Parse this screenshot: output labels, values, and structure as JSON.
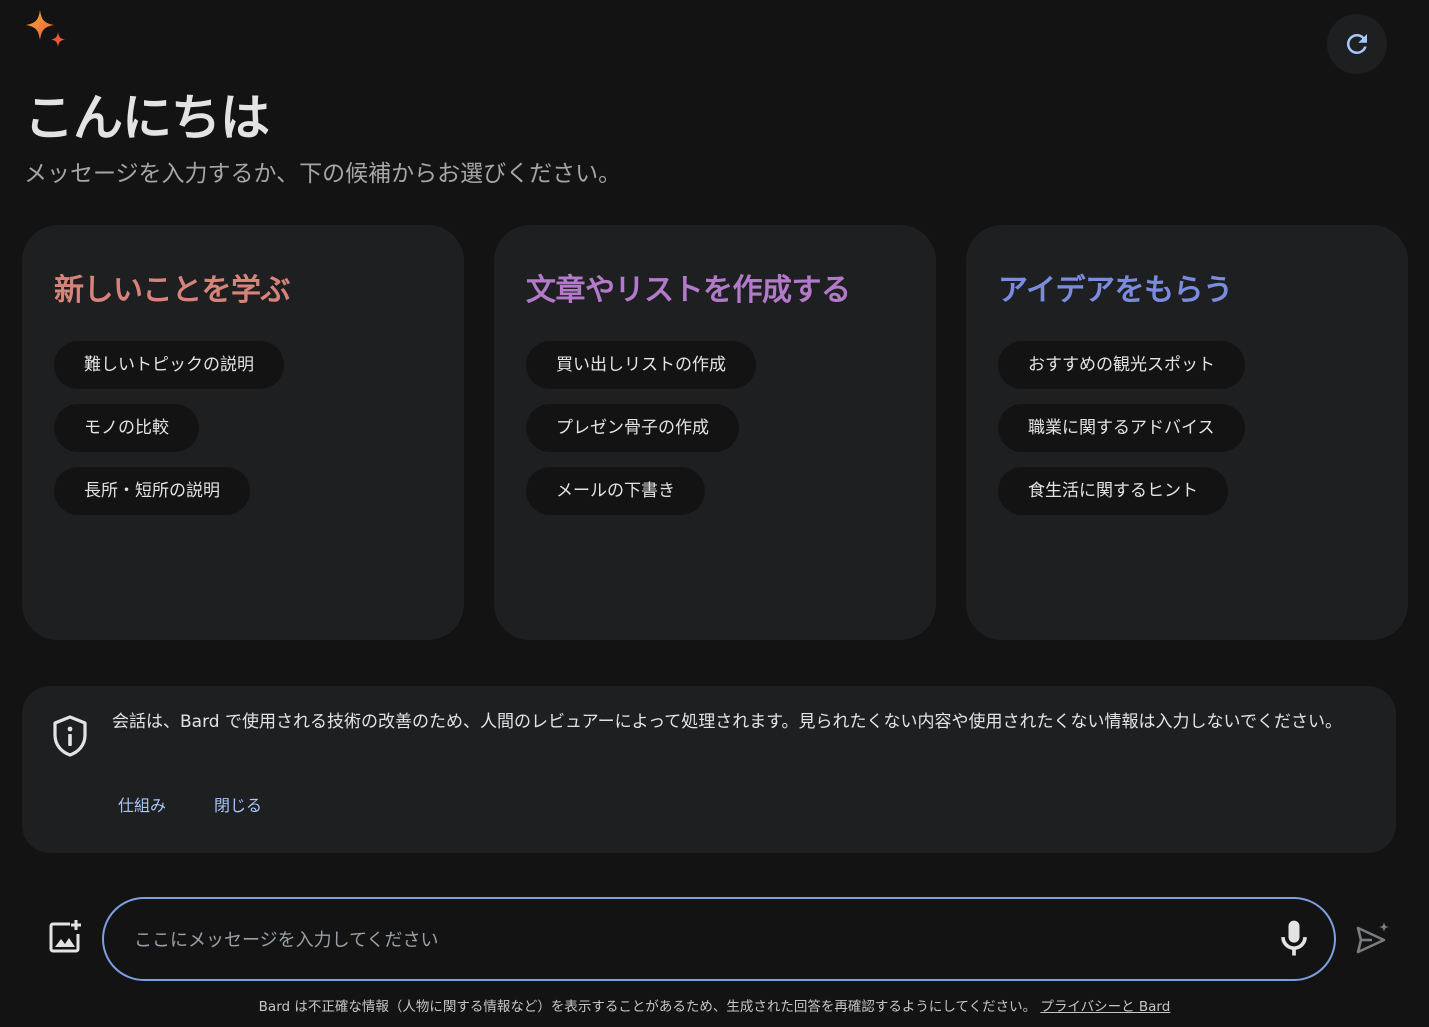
{
  "header": {
    "logo_icon": "sparkle-icon",
    "refresh_icon": "refresh-icon",
    "greeting": "こんにちは",
    "subtitle": "メッセージを入力するか、下の候補からお選びください。"
  },
  "cards": [
    {
      "title": "新しいことを学ぶ",
      "color": "#d7837a",
      "chips": [
        "難しいトピックの説明",
        "モノの比較",
        "長所・短所の説明"
      ]
    },
    {
      "title": "文章やリストを作成する",
      "color": "#b27ac9",
      "chips": [
        "買い出しリストの作成",
        "プレゼン骨子の作成",
        "メールの下書き"
      ]
    },
    {
      "title": "アイデアをもらう",
      "color": "#7b8ce0",
      "chips": [
        "おすすめの観光スポット",
        "職業に関するアドバイス",
        "食生活に関するヒント"
      ]
    }
  ],
  "notice": {
    "icon": "shield-info-icon",
    "text": "会話は、Bard で使用される技術の改善のため、人間のレビュアーによって処理されます。見られたくない内容や使用されたくない情報は入力しないでください。",
    "learn_more": "仕組み",
    "dismiss": "閉じる"
  },
  "composer": {
    "attach_icon": "add-image-icon",
    "placeholder": "ここにメッセージを入力してください",
    "mic_icon": "microphone-icon",
    "send_icon": "send-icon"
  },
  "footer": {
    "disclaimer": "Bard は不正確な情報（人物に関する情報など）を表示することがあるため、生成された回答を再確認するようにしてください。",
    "link": "プライバシーと Bard"
  }
}
